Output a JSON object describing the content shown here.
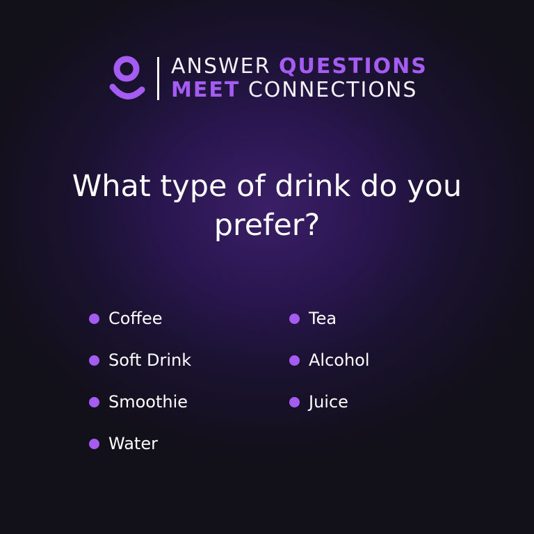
{
  "brand": {
    "logo_icon": "person-icon",
    "line1": {
      "word1": "ANSWER",
      "word2": "QUESTIONS"
    },
    "line2": {
      "word1": "MEET",
      "word2": "CONNECTIONS"
    },
    "accent_color": "#a45cf2"
  },
  "question": {
    "line1": "What type of drink do you",
    "line2": "prefer?"
  },
  "options": {
    "left": [
      "Coffee",
      "Soft Drink",
      "Smoothie",
      "Water"
    ],
    "right": [
      "Tea",
      "Alcohol",
      "Juice"
    ]
  },
  "colors": {
    "background": "#121019",
    "glow": "#3a1f66",
    "accent": "#a45cf2",
    "text": "#ffffff"
  }
}
